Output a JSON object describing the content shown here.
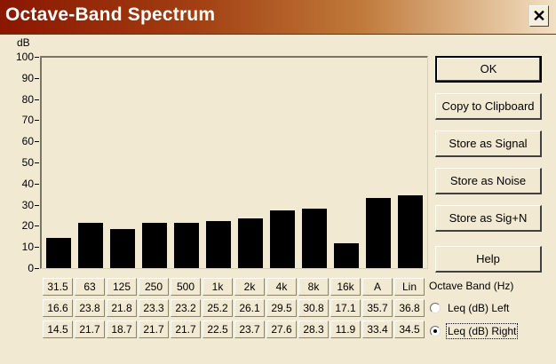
{
  "window": {
    "title": "Octave-Band Spectrum",
    "close_glyph": "✕"
  },
  "axis": {
    "unit": "dB",
    "ticks": [
      "100",
      "90",
      "80",
      "70",
      "60",
      "50",
      "40",
      "30",
      "20",
      "10",
      "0"
    ]
  },
  "chart_data": {
    "type": "bar",
    "ylabel": "dB",
    "ylim": [
      0,
      100
    ],
    "categories": [
      "31.5",
      "63",
      "125",
      "250",
      "500",
      "1k",
      "2k",
      "4k",
      "8k",
      "16k",
      "A",
      "Lin"
    ],
    "series": [
      {
        "name": "Leq (dB) Right",
        "values": [
          14.5,
          21.7,
          18.7,
          21.7,
          21.7,
          22.5,
          23.7,
          27.6,
          28.3,
          11.9,
          33.4,
          34.5
        ]
      }
    ],
    "bar_color": "#000000"
  },
  "table": {
    "band_heading": "Octave Band (Hz)",
    "bands": [
      "31.5",
      "63",
      "125",
      "250",
      "500",
      "1k",
      "2k",
      "4k",
      "8k",
      "16k",
      "A",
      "Lin"
    ],
    "left": [
      "16.6",
      "23.8",
      "21.8",
      "23.3",
      "23.2",
      "25.2",
      "26.1",
      "29.5",
      "30.8",
      "17.1",
      "35.7",
      "36.8"
    ],
    "right": [
      "14.5",
      "21.7",
      "18.7",
      "21.7",
      "21.7",
      "22.5",
      "23.7",
      "27.6",
      "28.3",
      "11.9",
      "33.4",
      "34.5"
    ]
  },
  "buttons": {
    "ok": "OK",
    "copy": "Copy to Clipboard",
    "store_signal": "Store as Signal",
    "store_noise": "Store as Noise",
    "store_sign": "Store as Sig+N",
    "help": "Help"
  },
  "radios": {
    "left_label": "Leq (dB) Left",
    "right_label": "Leq (dB) Right",
    "selected": "right"
  }
}
